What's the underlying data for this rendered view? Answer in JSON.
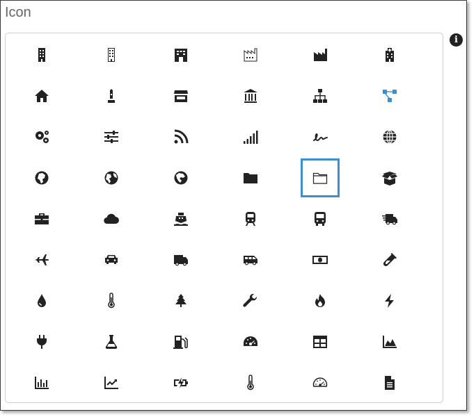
{
  "field": {
    "label": "Icon",
    "info_glyph": "i"
  },
  "accent_color": "#3b8fd0",
  "selected_icon": "folder-outline-icon",
  "icons": [
    "building-icon",
    "building-outline-icon",
    "store-building-icon",
    "factory-outline-icon",
    "factory-icon",
    "hospital-icon",
    "home-icon",
    "monument-icon",
    "store-icon",
    "bank-icon",
    "sitemap-icon",
    "network-icon",
    "gears-icon",
    "sliders-icon",
    "rss-icon",
    "signal-icon",
    "signature-icon",
    "globe-icon",
    "globe-africa-icon",
    "globe-americas-icon",
    "globe-asia-icon",
    "folder-icon",
    "folder-outline-icon",
    "box-open-icon",
    "briefcase-icon",
    "cloud-icon",
    "ship-icon",
    "train-icon",
    "bus-icon",
    "shipping-fast-icon",
    "plane-icon",
    "car-icon",
    "truck-icon",
    "shuttle-van-icon",
    "money-bill-icon",
    "vial-icon",
    "tint-icon",
    "thermometer-icon",
    "tree-icon",
    "wrench-icon",
    "fire-icon",
    "bolt-icon",
    "plug-icon",
    "flask-icon",
    "gas-pump-icon",
    "tachometer-icon",
    "table-icon",
    "area-chart-icon",
    "bar-chart-icon",
    "line-chart-icon",
    "battery-bolt-icon",
    "thermometer-outline-icon",
    "tachometer-outline-icon",
    "file-alt-icon"
  ]
}
